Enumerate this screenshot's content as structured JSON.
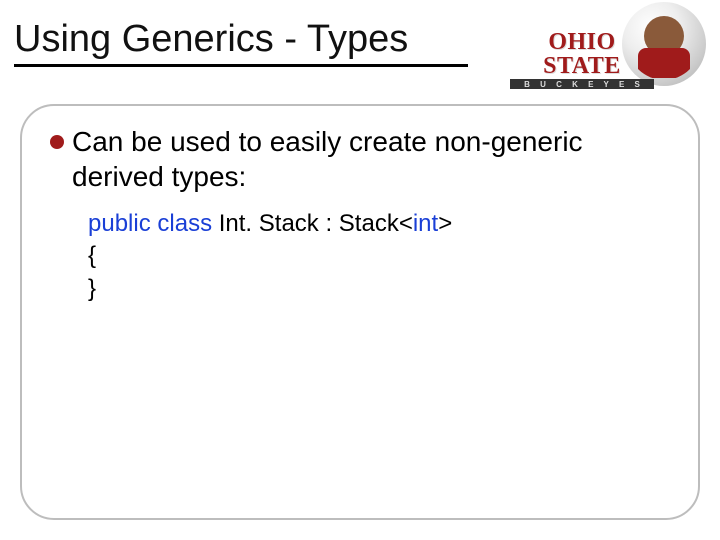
{
  "title": "Using Generics - Types",
  "logo": {
    "main": "OHIO STATE",
    "sub": "B U C K E Y E S"
  },
  "bullet": "Can be used to easily create non-generic derived types:",
  "code": {
    "kw_public": "public",
    "kw_class": "class",
    "class_plain": " Int. Stack : Stack<",
    "kw_int": "int",
    "end_angle": ">",
    "brace_open": "{",
    "brace_close": "}"
  }
}
